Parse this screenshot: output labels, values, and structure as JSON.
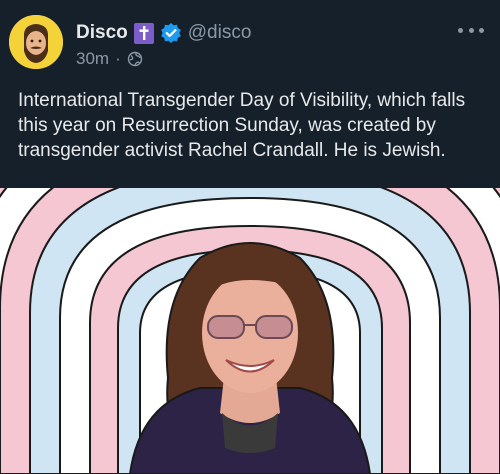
{
  "post": {
    "author_name": "Disco",
    "handle": "@disco",
    "timestamp": "30m",
    "separator": "·",
    "text": "International Transgender Day of Visibility, which falls this year on Resurrection Sunday, was created by transgender activist Rachel Crandall. He is Jewish."
  },
  "icons": {
    "cross_badge": "latin-cross-icon",
    "verified": "verified-badge-icon",
    "visibility": "globe-icon",
    "more": "more-options-icon"
  },
  "colors": {
    "background": "#15202b",
    "text_primary": "#e7e9ea",
    "text_secondary": "#8b98a5",
    "verified_blue": "#1d9bf0",
    "cross_badge_purple": "#7b5cc9",
    "avatar_yellow": "#f4d23a",
    "stripe_pink": "#f5c7d3",
    "stripe_blue": "#cfe5f3",
    "stripe_white": "#ffffff"
  }
}
